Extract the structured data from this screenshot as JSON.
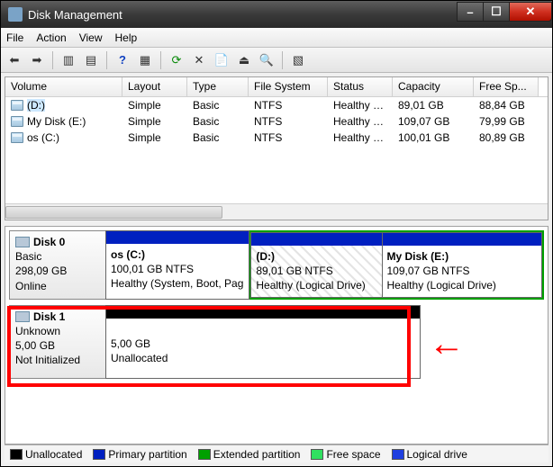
{
  "window": {
    "title": "Disk Management"
  },
  "menu": {
    "file": "File",
    "action": "Action",
    "view": "View",
    "help": "Help"
  },
  "columns": [
    "Volume",
    "Layout",
    "Type",
    "File System",
    "Status",
    "Capacity",
    "Free Sp..."
  ],
  "volumes": [
    {
      "name": "(D:)",
      "layout": "Simple",
      "type": "Basic",
      "fs": "NTFS",
      "status": "Healthy (L...",
      "cap": "89,01 GB",
      "free": "88,84 GB",
      "selected": true
    },
    {
      "name": "My Disk (E:)",
      "layout": "Simple",
      "type": "Basic",
      "fs": "NTFS",
      "status": "Healthy (L...",
      "cap": "109,07 GB",
      "free": "79,99 GB",
      "selected": false
    },
    {
      "name": "os (C:)",
      "layout": "Simple",
      "type": "Basic",
      "fs": "NTFS",
      "status": "Healthy (S...",
      "cap": "100,01 GB",
      "free": "80,89 GB",
      "selected": false
    }
  ],
  "disk0": {
    "title": "Disk 0",
    "type": "Basic",
    "size": "298,09 GB",
    "state": "Online",
    "p1": {
      "name": "os  (C:)",
      "line2": "100,01 GB NTFS",
      "line3": "Healthy (System, Boot, Pag"
    },
    "p2": {
      "name": "(D:)",
      "line2": "89,01 GB NTFS",
      "line3": "Healthy (Logical Drive)"
    },
    "p3": {
      "name": "My Disk  (E:)",
      "line2": "109,07 GB NTFS",
      "line3": "Healthy (Logical Drive)"
    }
  },
  "disk1": {
    "title": "Disk 1",
    "type": "Unknown",
    "size": "5,00 GB",
    "state": "Not Initialized",
    "p1": {
      "line2": "5,00 GB",
      "line3": "Unallocated"
    }
  },
  "legend": {
    "unalloc": "Unallocated",
    "primary": "Primary partition",
    "extended": "Extended partition",
    "free": "Free space",
    "logical": "Logical drive"
  }
}
